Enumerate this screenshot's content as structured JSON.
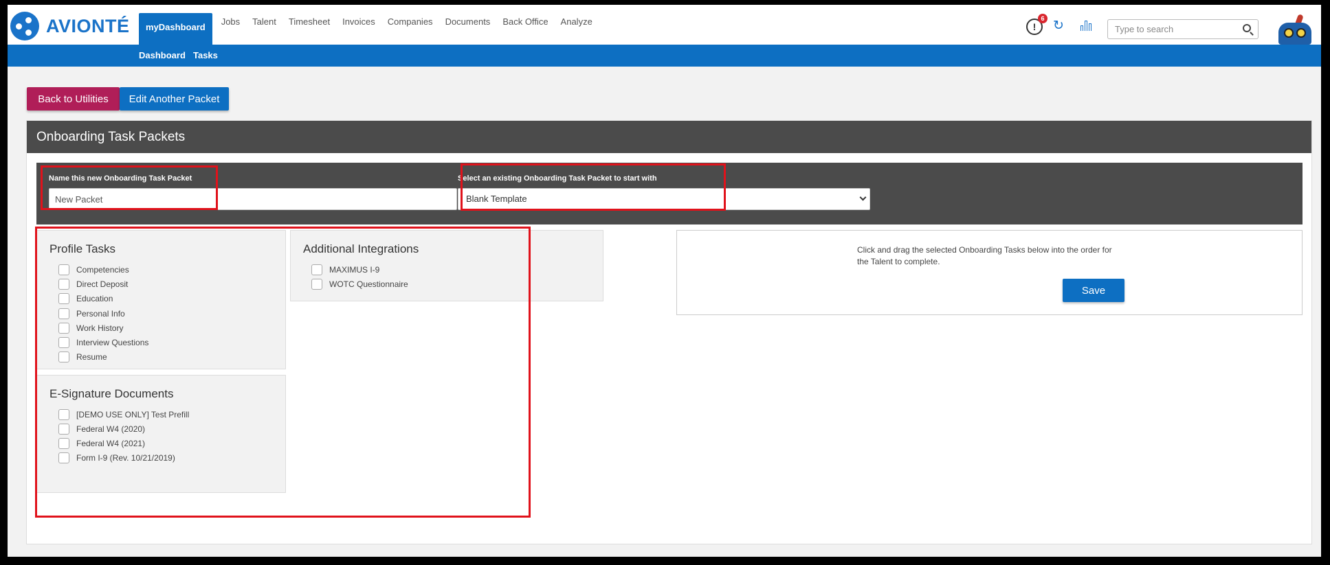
{
  "brand": {
    "name": "AVIONTÉ"
  },
  "nav": {
    "tabs": [
      {
        "label": "myDashboard",
        "active": true
      },
      {
        "label": "Jobs"
      },
      {
        "label": "Talent"
      },
      {
        "label": "Timesheet"
      },
      {
        "label": "Invoices"
      },
      {
        "label": "Companies"
      },
      {
        "label": "Documents"
      },
      {
        "label": "Back Office"
      },
      {
        "label": "Analyze"
      }
    ],
    "notification_count": "6",
    "user_icon_glyph": "!",
    "refresh_glyph": "↻",
    "search_placeholder": "Type to search",
    "accent_color": "#0d6fc2"
  },
  "subnav": {
    "items": [
      "Dashboard",
      "Tasks"
    ]
  },
  "actions": {
    "back_label": "Back to Utilities",
    "edit_label": "Edit Another Packet"
  },
  "card": {
    "title": "Onboarding Task Packets",
    "name_label": "Name this new Onboarding Task Packet",
    "name_value": "New Packet",
    "select_label": "Select an existing Onboarding Task Packet to start with",
    "select_value": "Blank Template"
  },
  "profile_tasks": {
    "title": "Profile Tasks",
    "items": [
      "Competencies",
      "Direct Deposit",
      "Education",
      "Personal Info",
      "Work History",
      "Interview Questions",
      "Resume"
    ]
  },
  "integrations": {
    "title": "Additional Integrations",
    "items": [
      "MAXIMUS I-9",
      "WOTC Questionnaire"
    ]
  },
  "esign": {
    "title": "E-Signature Documents",
    "items": [
      "[DEMO USE ONLY] Test Prefill",
      "Federal W4 (2020)",
      "Federal W4 (2021)",
      "Form I-9 (Rev. 10/21/2019)"
    ]
  },
  "drop_zone": {
    "instructions": "Click and drag the selected Onboarding Tasks below into the order for the Talent to complete.",
    "save_label": "Save"
  }
}
